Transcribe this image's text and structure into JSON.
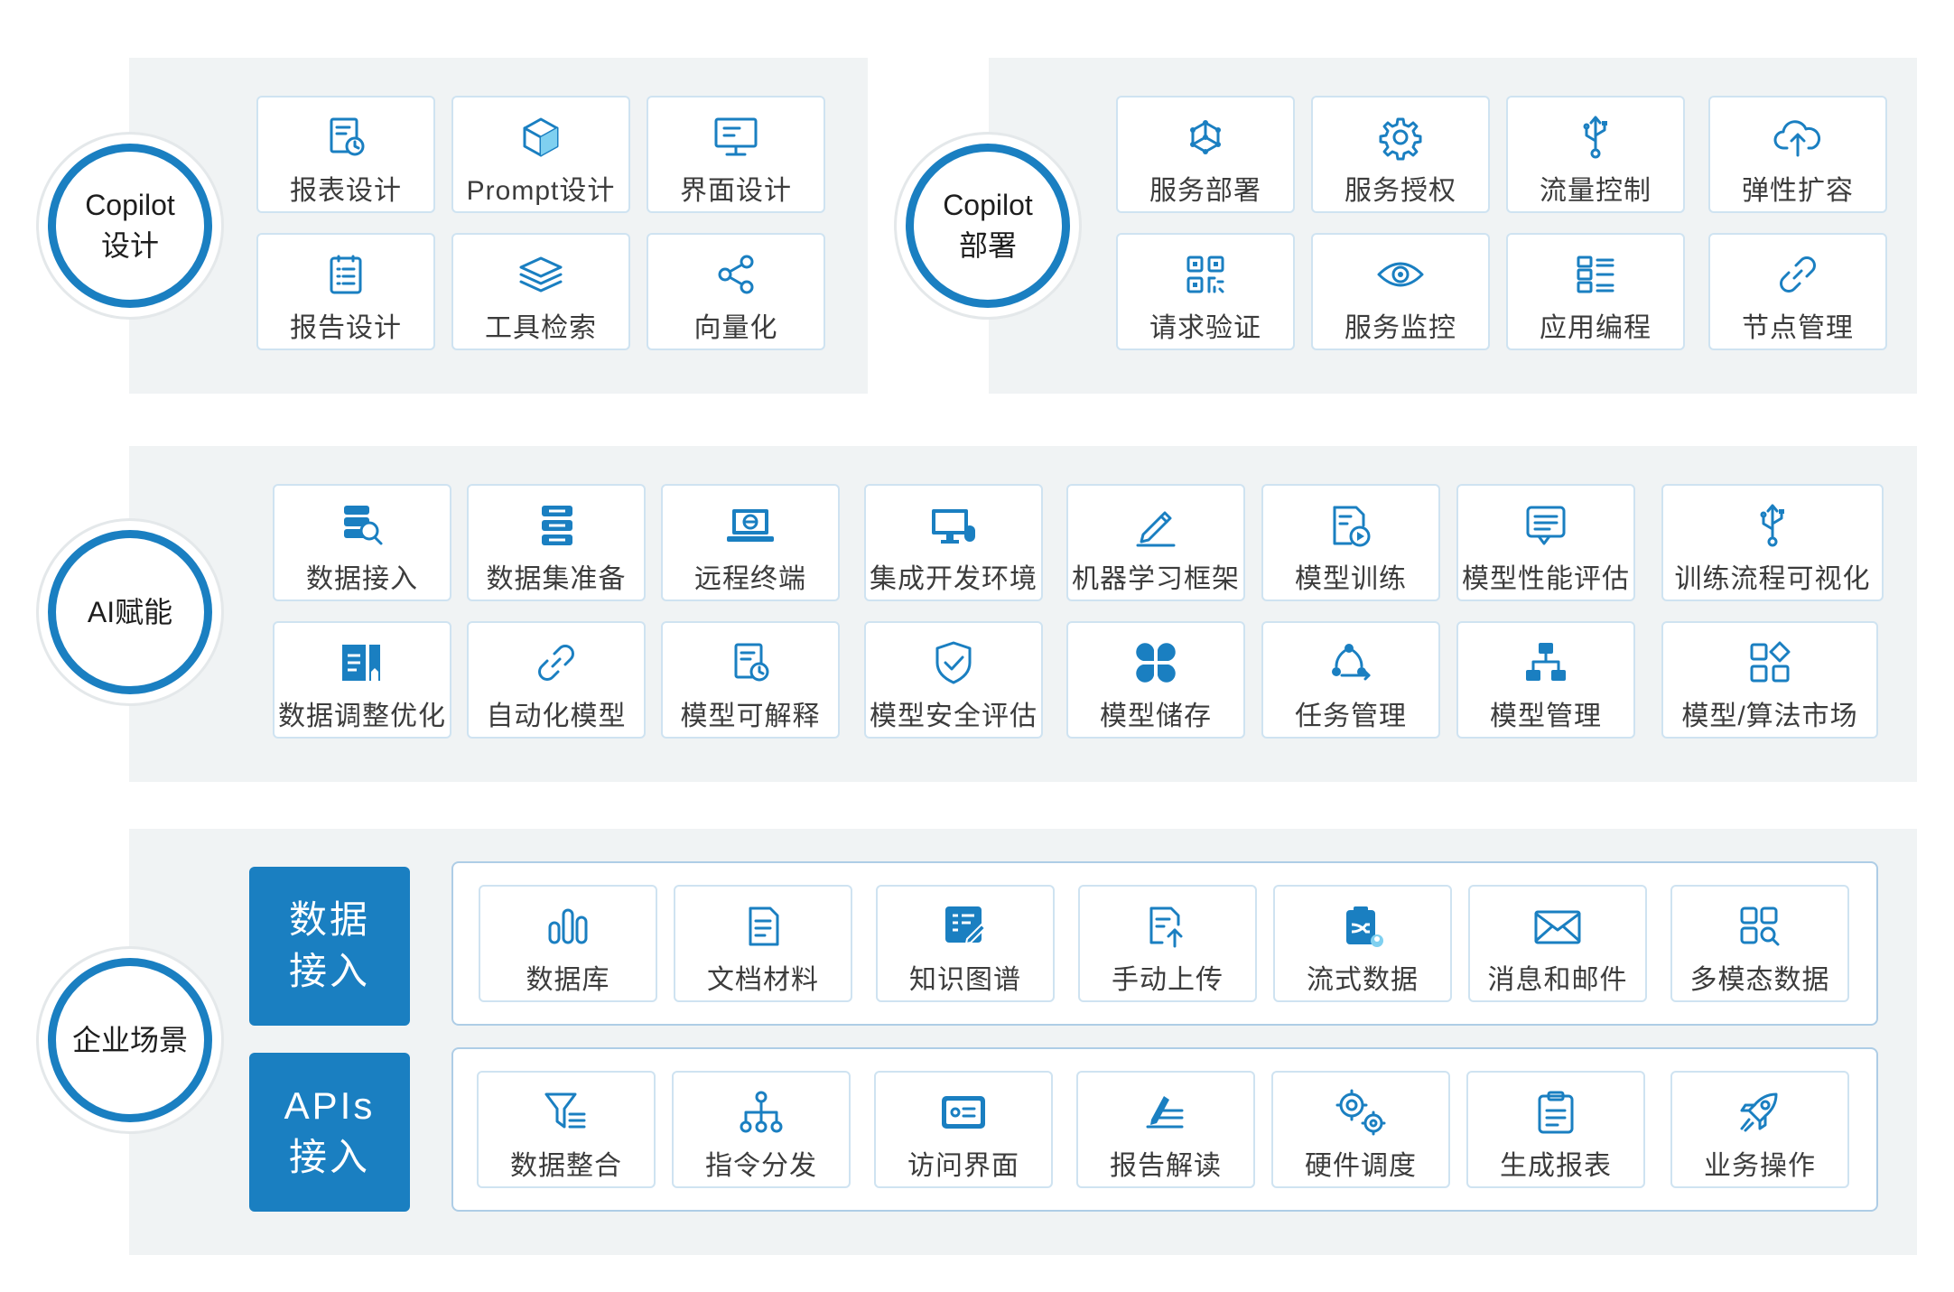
{
  "colors": {
    "accent": "#1a7fc1",
    "panel_bg": "#f0f3f4",
    "card_border": "#cfe3f1"
  },
  "sections": {
    "copilot_design": {
      "title_line1": "Copilot",
      "title_line2": "设计",
      "items": [
        {
          "label": "报表设计",
          "icon": "report-clock-icon"
        },
        {
          "label": "Prompt设计",
          "icon": "cube-icon"
        },
        {
          "label": "界面设计",
          "icon": "monitor-icon"
        },
        {
          "label": "报告设计",
          "icon": "document-list-icon"
        },
        {
          "label": "工具检索",
          "icon": "layers-icon"
        },
        {
          "label": "向量化",
          "icon": "share-nodes-icon"
        }
      ]
    },
    "copilot_deploy": {
      "title_line1": "Copilot",
      "title_line2": "部署",
      "items": [
        {
          "label": "服务部署",
          "icon": "network-cube-icon"
        },
        {
          "label": "服务授权",
          "icon": "gear-icon"
        },
        {
          "label": "流量控制",
          "icon": "usb-icon"
        },
        {
          "label": "弹性扩容",
          "icon": "cloud-upload-icon"
        },
        {
          "label": "请求验证",
          "icon": "qr-code-icon"
        },
        {
          "label": "服务监控",
          "icon": "eye-icon"
        },
        {
          "label": "应用编程",
          "icon": "list-grid-icon"
        },
        {
          "label": "节点管理",
          "icon": "link-icon"
        }
      ]
    },
    "ai_empower": {
      "title": "AI赋能",
      "items": [
        {
          "label": "数据接入",
          "icon": "database-search-icon"
        },
        {
          "label": "数据集准备",
          "icon": "database-stack-icon"
        },
        {
          "label": "远程终端",
          "icon": "laptop-browser-icon"
        },
        {
          "label": "集成开发环境",
          "icon": "desktop-mouse-icon"
        },
        {
          "label": "机器学习框架",
          "icon": "pencil-icon"
        },
        {
          "label": "模型训练",
          "icon": "video-document-icon"
        },
        {
          "label": "模型性能评估",
          "icon": "message-list-icon"
        },
        {
          "label": "训练流程可视化",
          "icon": "usb-icon"
        },
        {
          "label": "数据调整优化",
          "icon": "bookmark-file-icon"
        },
        {
          "label": "自动化模型",
          "icon": "link-icon"
        },
        {
          "label": "模型可解释",
          "icon": "report-clock-icon"
        },
        {
          "label": "模型安全评估",
          "icon": "shield-check-icon"
        },
        {
          "label": "模型储存",
          "icon": "clover-icon"
        },
        {
          "label": "任务管理",
          "icon": "cycle-arrow-icon"
        },
        {
          "label": "模型管理",
          "icon": "org-chart-icon"
        },
        {
          "label": "模型/算法市场",
          "icon": "apps-diamond-icon"
        }
      ]
    },
    "enterprise": {
      "title": "企业场景",
      "data_access": {
        "title_line1": "数据",
        "title_line2": "接入",
        "items": [
          {
            "label": "数据库",
            "icon": "bar-chart-icon"
          },
          {
            "label": "文档材料",
            "icon": "document-icon"
          },
          {
            "label": "知识图谱",
            "icon": "edit-list-icon"
          },
          {
            "label": "手动上传",
            "icon": "upload-file-icon"
          },
          {
            "label": "流式数据",
            "icon": "clipboard-shuffle-icon"
          },
          {
            "label": "消息和邮件",
            "icon": "envelope-icon"
          },
          {
            "label": "多模态数据",
            "icon": "grid-search-icon"
          }
        ]
      },
      "api_access": {
        "title_line1": "APIs",
        "title_line2": "接入",
        "items": [
          {
            "label": "数据整合",
            "icon": "filter-icon"
          },
          {
            "label": "指令分发",
            "icon": "tree-nodes-icon"
          },
          {
            "label": "访问界面",
            "icon": "id-card-icon"
          },
          {
            "label": "报告解读",
            "icon": "pen-lines-icon"
          },
          {
            "label": "硬件调度",
            "icon": "gears-icon"
          },
          {
            "label": "生成报表",
            "icon": "clipboard-icon"
          },
          {
            "label": "业务操作",
            "icon": "rocket-icon"
          }
        ]
      }
    }
  }
}
